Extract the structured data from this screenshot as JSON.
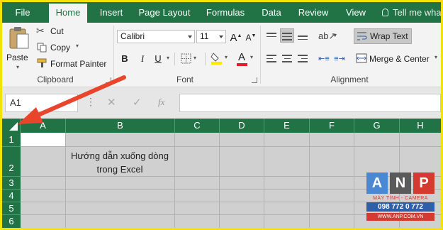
{
  "ribbon": {
    "tabs": [
      "File",
      "Home",
      "Insert",
      "Page Layout",
      "Formulas",
      "Data",
      "Review",
      "View"
    ],
    "tell_me": "Tell me wha",
    "clipboard": {
      "paste": "Paste",
      "cut": "Cut",
      "copy": "Copy",
      "format_painter": "Format Painter",
      "label": "Clipboard"
    },
    "font": {
      "name": "Calibri",
      "size": "11",
      "bold": "B",
      "italic": "I",
      "underline": "U",
      "grow": "A",
      "shrink": "A",
      "font_color": "A",
      "label": "Font"
    },
    "alignment": {
      "wrap_text": "Wrap Text",
      "merge_center": "Merge & Center",
      "label": "Alignment"
    }
  },
  "formula_bar": {
    "name_box": "A1",
    "fx": "fx",
    "value": ""
  },
  "grid": {
    "columns": [
      "A",
      "B",
      "C",
      "D",
      "E",
      "F",
      "G",
      "H"
    ],
    "rows": [
      "1",
      "2",
      "3",
      "4",
      "5",
      "6"
    ],
    "cell_b2_line1": "Hướng dẫn xuống dòng",
    "cell_b2_line2": "trong Excel"
  },
  "watermark": {
    "letters": [
      "A",
      "N",
      "P"
    ],
    "tagline": "MÁY TÍNH - CAMERA",
    "phone": "098 772 0 772",
    "website": "WWW.ANP.COM.VN"
  },
  "colors": {
    "excel_green": "#217346",
    "annotation_arrow": "#e8452c",
    "frame": "#f2e20a"
  }
}
